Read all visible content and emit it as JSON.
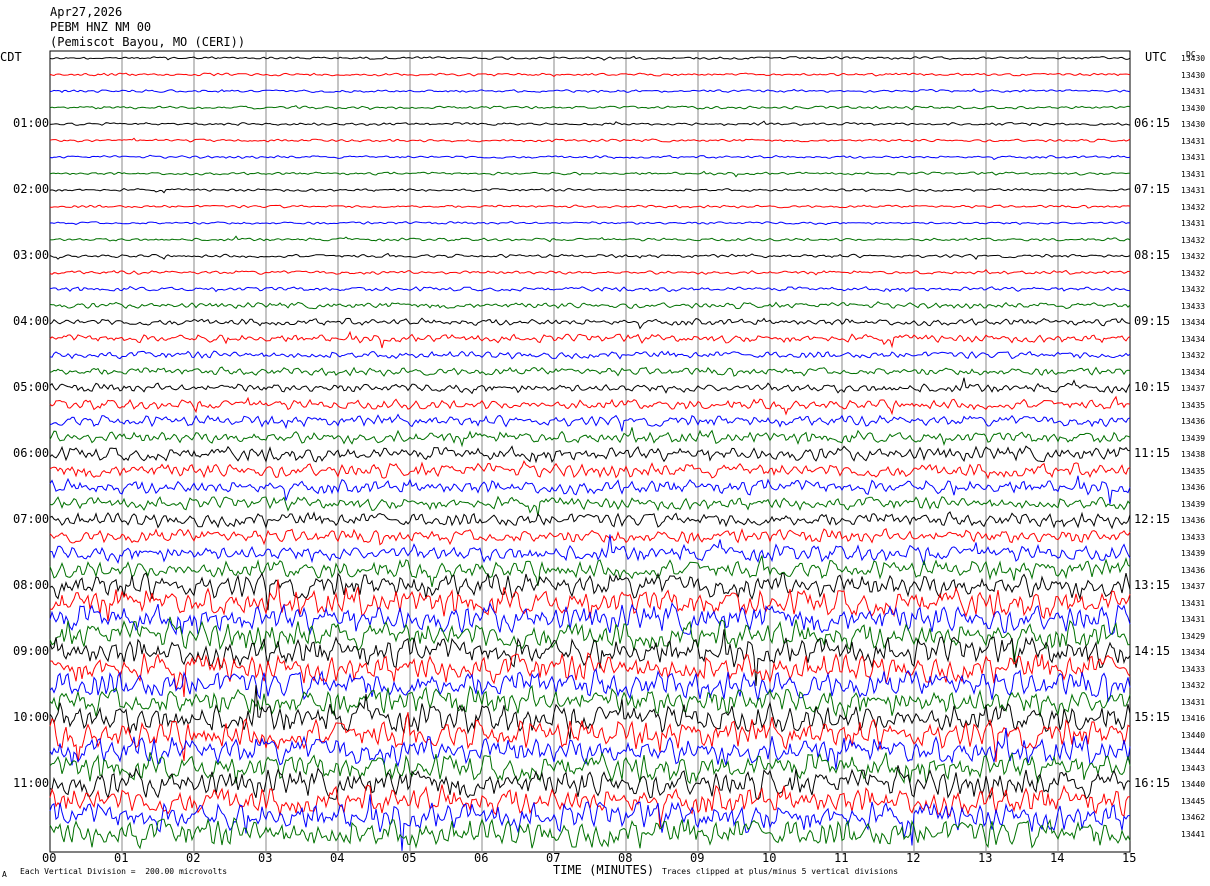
{
  "header": {
    "date": "Apr27,2026",
    "station": "PEBM HNZ NM 00",
    "location": "(Pemiscot Bayou, MO (CERI))"
  },
  "left_axis_title": "CDT",
  "right_axis_title": "UTC",
  "dc_title": "DC",
  "footer": {
    "scale_note": "Each Vertical Division =  200.00 microvolts",
    "xlabel": "TIME (MINUTES)",
    "clip_note": "Traces clipped at plus/minus 5 vertical divisions",
    "corner_mark": "A"
  },
  "chart_data": {
    "type": "line",
    "x_ticks": [
      "00",
      "01",
      "02",
      "03",
      "04",
      "05",
      "06",
      "07",
      "08",
      "09",
      "10",
      "11",
      "12",
      "13",
      "14",
      "15"
    ],
    "xlim": [
      0,
      15
    ],
    "trace_colors": [
      "#000000",
      "#ff0000",
      "#0000ff",
      "#007000"
    ],
    "left_labels": [
      "01:00",
      "02:00",
      "03:00",
      "04:00",
      "05:00",
      "06:00",
      "07:00",
      "08:00",
      "09:00",
      "10:00",
      "11:00"
    ],
    "right_labels": [
      "06:15",
      "07:15",
      "08:15",
      "09:15",
      "10:15",
      "11:15",
      "12:15",
      "13:15",
      "14:15",
      "15:15",
      "16:15"
    ],
    "dc_offsets": [
      "13430",
      "13430",
      "13431",
      "13430",
      "13430",
      "13431",
      "13431",
      "13431",
      "13431",
      "13432",
      "13431",
      "13432",
      "13432",
      "13432",
      "13432",
      "13433",
      "13434",
      "13434",
      "13432",
      "13434",
      "13437",
      "13435",
      "13436",
      "13439",
      "13438",
      "13435",
      "13436",
      "13439",
      "13436",
      "13433",
      "13439",
      "13436",
      "13437",
      "13431",
      "13431",
      "13429",
      "13434",
      "13433",
      "13432",
      "13431",
      "13416",
      "13440",
      "13444",
      "13443",
      "13440",
      "13445",
      "13462",
      "13441"
    ],
    "trace_amplitude": [
      1.5,
      1.5,
      1.5,
      1.5,
      1.5,
      1.5,
      1.5,
      1.5,
      1.5,
      1.5,
      1.5,
      1.6,
      1.8,
      2.0,
      2.5,
      3.2,
      3.8,
      4.5,
      4.0,
      4.5,
      5,
      5.5,
      6,
      7,
      8,
      8,
      8,
      7,
      8,
      8,
      9,
      10,
      14,
      16,
      16,
      16,
      16,
      16,
      16,
      16,
      16,
      16,
      16,
      16,
      16,
      16,
      16,
      16
    ]
  }
}
